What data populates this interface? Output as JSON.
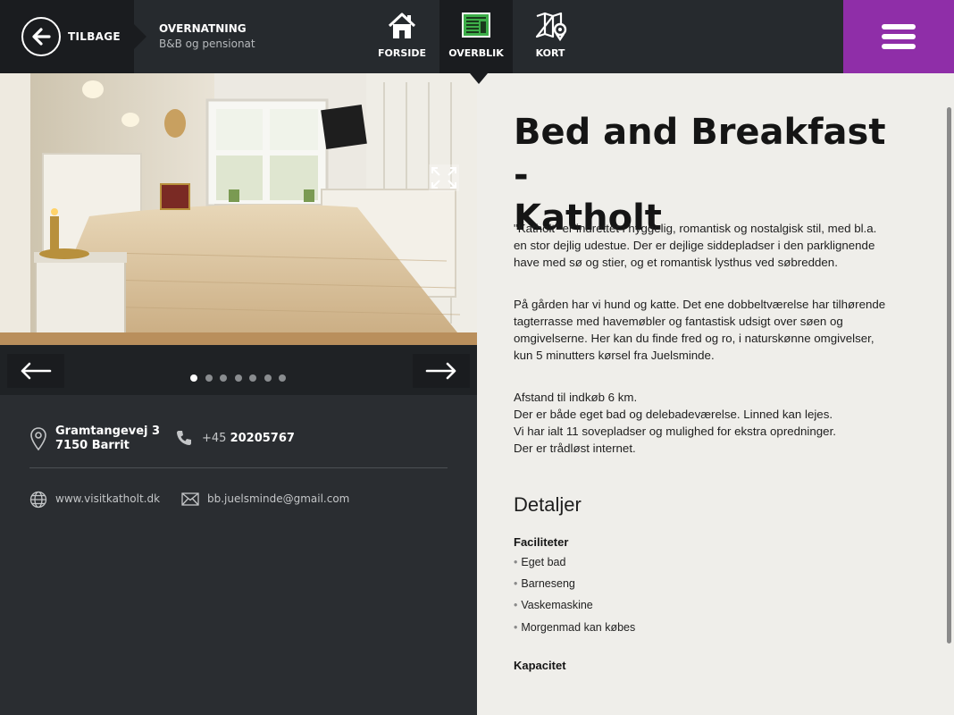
{
  "header": {
    "back_label": "TILBAGE",
    "crumb_title": "OVERNATNING",
    "crumb_subtitle": "B&B og pensionat",
    "tabs": [
      {
        "label": "FORSIDE",
        "icon": "home-icon"
      },
      {
        "label": "OVERBLIK",
        "icon": "overview-icon",
        "active": true
      },
      {
        "label": "KORT",
        "icon": "map-icon"
      }
    ],
    "menu_icon": "hamburger-menu-icon",
    "accent_color": "#8f2ea8"
  },
  "gallery": {
    "total_slides": 7,
    "active_slide": 1
  },
  "contact": {
    "address_line1": "Gramtangevej 3",
    "address_line2": "7150 Barrit",
    "phone_prefix": "+45",
    "phone_number": "20205767",
    "website": "www.visitkatholt.dk",
    "email": "bb.juelsminde@gmail.com"
  },
  "detail": {
    "title_line1": "Bed and Breakfast -",
    "title_line2": "Katholt",
    "para1": [
      "\"Katholt\" er indrettet i hyggelig, romantisk og nostalgisk stil, med bl.a.",
      "en stor dejlig udestue. Der er dejlige siddepladser i den parklignende",
      "have med sø og stier, og et romantisk lysthus ved søbredden."
    ],
    "para2": [
      "På gården har vi hund og katte. Det ene dobbeltværelse har tilhørende",
      "tagterrasse med havemøbler og fantastisk udsigt over søen og",
      "omgivelserne. Her kan du finde fred og ro, i naturskønne omgivelser,",
      "kun 5 minutters kørsel fra Juelsminde."
    ],
    "para3": [
      "Afstand til indkøb 6 km.",
      "Der er både eget bad og delebadeværelse. Linned kan lejes.",
      "Vi har ialt 11 sovepladser og mulighed for ekstra opredninger.",
      "Der er trådløst internet."
    ],
    "details_heading": "Detaljer",
    "facilities_heading": "Faciliteter",
    "facilities": [
      "Eget bad",
      "Barneseng",
      "Vaskemaskine",
      "Morgenmad kan købes"
    ],
    "capacity_heading": "Kapacitet"
  }
}
